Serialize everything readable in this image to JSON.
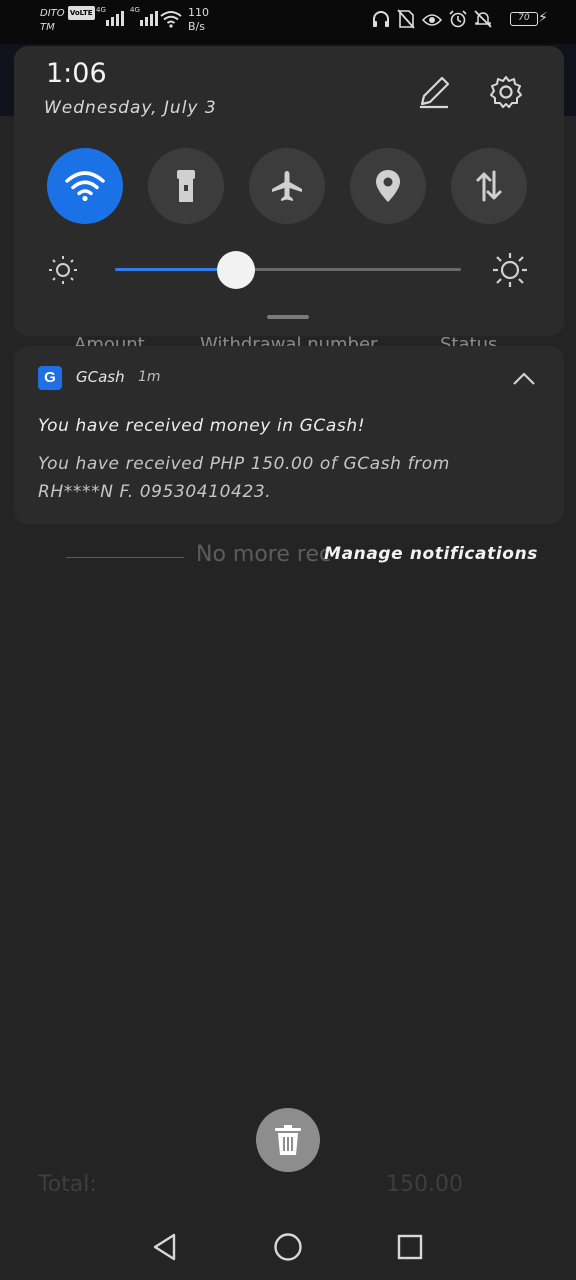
{
  "status_bar": {
    "carrier_line1": "DITO",
    "carrier_line2": "TM",
    "volte": "VoLTE",
    "net1": "4G",
    "net2": "4G",
    "speed_value": "110",
    "speed_unit": "B/s",
    "battery": "70",
    "icons": [
      "headphones-icon",
      "no-sim-icon",
      "eye-icon",
      "alarm-icon",
      "mute-icon",
      "battery-icon",
      "charging-icon"
    ]
  },
  "shade": {
    "time": "1:06",
    "date": "Wednesday, July 3",
    "quick_settings": [
      {
        "name": "wifi",
        "icon": "wifi-icon",
        "active": true
      },
      {
        "name": "flashlight",
        "icon": "flashlight-icon",
        "active": false
      },
      {
        "name": "airplane",
        "icon": "airplane-icon",
        "active": false
      },
      {
        "name": "location",
        "icon": "location-icon",
        "active": false
      },
      {
        "name": "mobile-data",
        "icon": "mobile-data-icon",
        "active": false
      }
    ],
    "brightness_fraction": 0.35,
    "accent_color": "#1a72e6"
  },
  "background_app": {
    "col1": "Amount",
    "col2": "Withdrawal number",
    "col3": "Status",
    "no_more": "No more rec",
    "total_label": "Total:",
    "total_value": "150.00"
  },
  "notification": {
    "app_icon_letter": "G",
    "app_name": "GCash",
    "time_ago": "1m",
    "title": "You have received money in GCash!",
    "body": "You have received PHP 150.00 of GCash from RH****N F. 09530410423."
  },
  "manage_notifications": "Manage notifications"
}
